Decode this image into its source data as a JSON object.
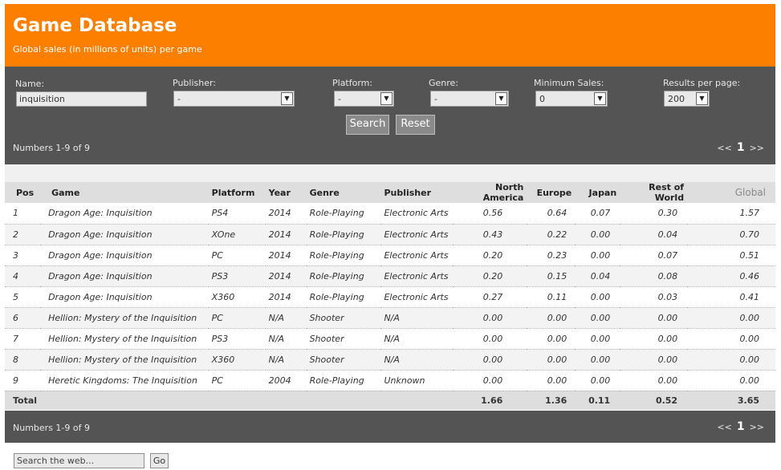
{
  "header": {
    "title": "Game Database",
    "subtitle": "Global sales (in millions of units) per game"
  },
  "filters": {
    "name_label": "Name:",
    "name_value": "inquisition",
    "publisher_label": "Publisher:",
    "publisher_value": "-",
    "platform_label": "Platform:",
    "platform_value": "-",
    "genre_label": "Genre:",
    "genre_value": "-",
    "minsales_label": "Minimum Sales:",
    "minsales_value": "0",
    "rpp_label": "Results per page:",
    "rpp_value": "200",
    "search_button": "Search",
    "reset_button": "Reset"
  },
  "pagination": {
    "summary": "Numbers 1-9 of 9",
    "prev": "<<",
    "current": "1",
    "next": ">>"
  },
  "table": {
    "columns": [
      "Pos",
      "Game",
      "Platform",
      "Year",
      "Genre",
      "Publisher",
      "North America",
      "Europe",
      "Japan",
      "Rest of World",
      "Global"
    ],
    "rows": [
      [
        "1",
        "Dragon Age: Inquisition",
        "PS4",
        "2014",
        "Role-Playing",
        "Electronic Arts",
        "0.56",
        "0.64",
        "0.07",
        "0.30",
        "1.57"
      ],
      [
        "2",
        "Dragon Age: Inquisition",
        "XOne",
        "2014",
        "Role-Playing",
        "Electronic Arts",
        "0.43",
        "0.22",
        "0.00",
        "0.04",
        "0.70"
      ],
      [
        "3",
        "Dragon Age: Inquisition",
        "PC",
        "2014",
        "Role-Playing",
        "Electronic Arts",
        "0.20",
        "0.23",
        "0.00",
        "0.07",
        "0.51"
      ],
      [
        "4",
        "Dragon Age: Inquisition",
        "PS3",
        "2014",
        "Role-Playing",
        "Electronic Arts",
        "0.20",
        "0.15",
        "0.04",
        "0.08",
        "0.46"
      ],
      [
        "5",
        "Dragon Age: Inquisition",
        "X360",
        "2014",
        "Role-Playing",
        "Electronic Arts",
        "0.27",
        "0.11",
        "0.00",
        "0.03",
        "0.41"
      ],
      [
        "6",
        "Hellion: Mystery of the Inquisition",
        "PC",
        "N/A",
        "Shooter",
        "N/A",
        "0.00",
        "0.00",
        "0.00",
        "0.00",
        "0.00"
      ],
      [
        "7",
        "Hellion: Mystery of the Inquisition",
        "PS3",
        "N/A",
        "Shooter",
        "N/A",
        "0.00",
        "0.00",
        "0.00",
        "0.00",
        "0.00"
      ],
      [
        "8",
        "Hellion: Mystery of the Inquisition",
        "X360",
        "N/A",
        "Shooter",
        "N/A",
        "0.00",
        "0.00",
        "0.00",
        "0.00",
        "0.00"
      ],
      [
        "9",
        "Heretic Kingdoms: The Inquisition",
        "PC",
        "2004",
        "Role-Playing",
        "Unknown",
        "0.00",
        "0.00",
        "0.00",
        "0.00",
        "0.00"
      ]
    ],
    "total": {
      "label": "Total",
      "north_america": "1.66",
      "europe": "1.36",
      "japan": "0.11",
      "rest_of_world": "0.52",
      "global": "3.65"
    }
  },
  "web_search": {
    "placeholder": "Search the web...",
    "button": "Go"
  },
  "colors": {
    "header_bg": "#fc7f00",
    "panel_bg": "#545454",
    "table_header_bg": "#dedede"
  }
}
